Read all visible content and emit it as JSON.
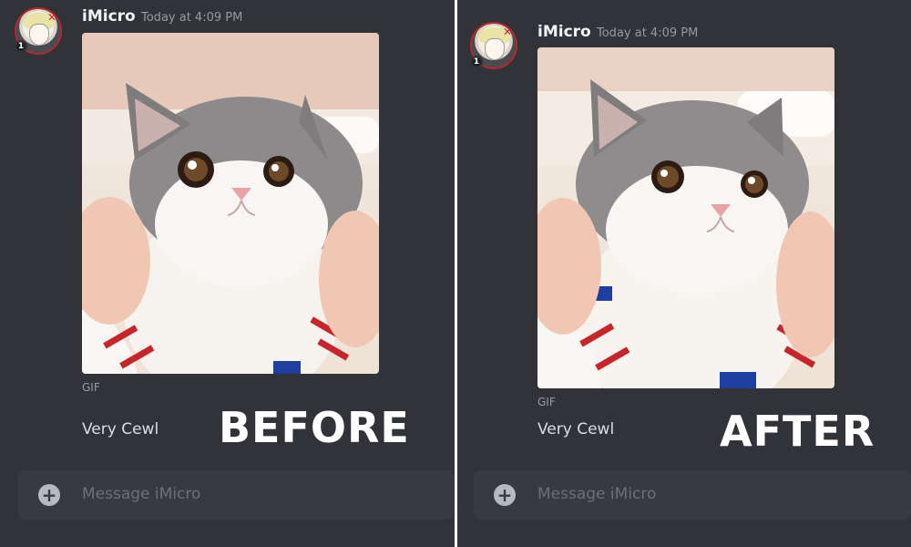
{
  "before": {
    "username": "iMicro",
    "timestamp": "Today at 4:09 PM",
    "gif_label": "GIF",
    "message": "Very Cewl",
    "compose_placeholder": "Message iMicro",
    "overlay_label": "BEFORE",
    "badge": "1"
  },
  "after": {
    "username": "iMicro",
    "timestamp": "Today at 4:09 PM",
    "gif_label": "GIF",
    "message": "Very Cewl",
    "compose_placeholder": "Message iMicro",
    "overlay_label": "AFTER",
    "badge": "1"
  },
  "compose_plus_icon": "plus-circle-icon",
  "colors": {
    "background": "#313338",
    "compose": "#383a40",
    "username": "#f2f3f5",
    "timestamp": "#949ba4",
    "message": "#dbdee1",
    "placeholder": "#6d6f78",
    "divider": "#ffffff"
  }
}
